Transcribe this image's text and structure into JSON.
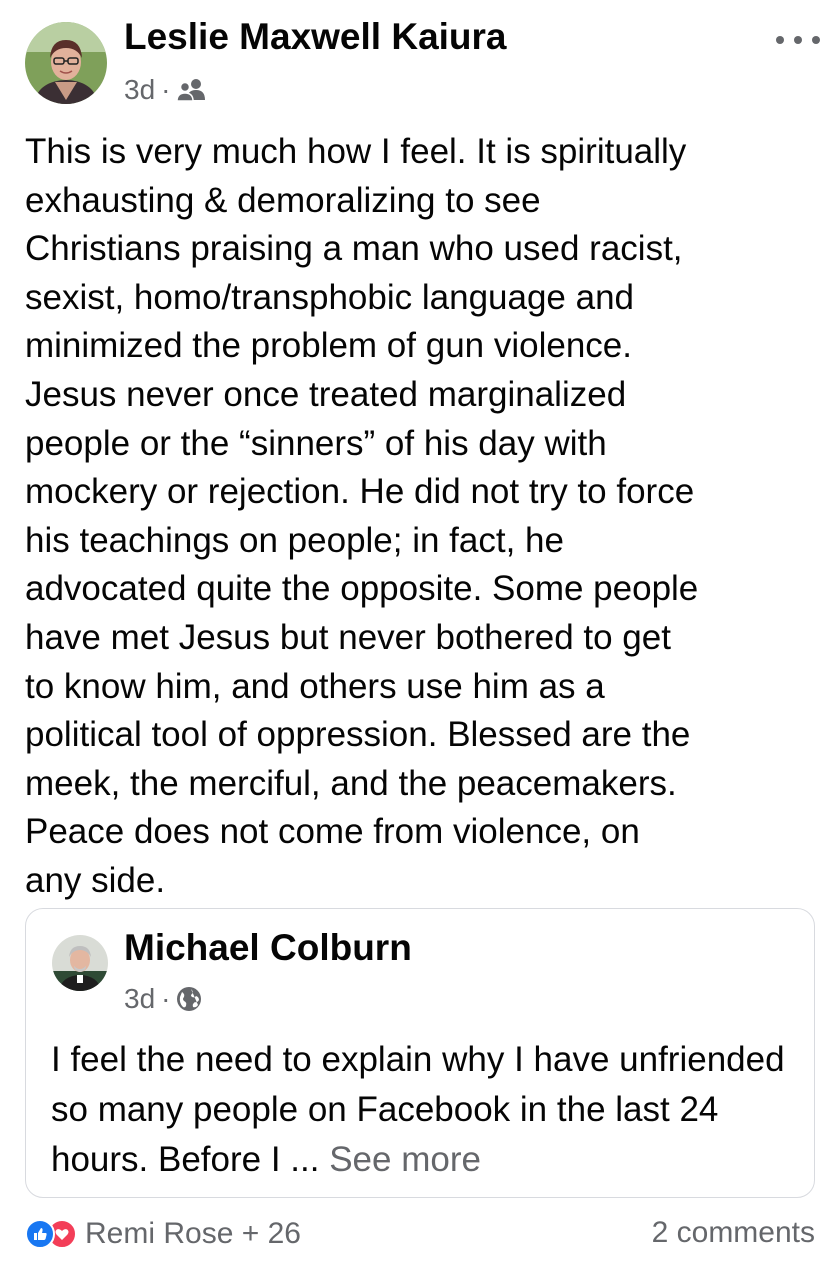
{
  "post": {
    "author_name": "Leslie Maxwell Kaiura",
    "timestamp": "3d",
    "separator": "·",
    "audience_icon": "friends-icon",
    "body": "This is very much how I feel. It is spiritually\nexhausting & demoralizing to see\nChristians praising a man who used racist,\nsexist, homo/transphobic language and\nminimized the problem of gun violence.\nJesus never once treated marginalized\npeople or the “sinners” of his day with\nmockery or rejection. He did not try to force\nhis teachings on people; in fact, he\nadvocated quite the opposite. Some people\nhave met Jesus but never bothered to get\nto know him, and others use him as a\npolitical tool of oppression. Blessed are the\nmeek, the merciful, and the peacemakers.\nPeace does not come from violence, on\nany side."
  },
  "shared": {
    "author_name": "Michael Colburn",
    "timestamp": "3d",
    "separator": "·",
    "audience_icon": "globe-icon",
    "body": "I feel the need to explain why I have unfriended so many people on Facebook in the last 24 hours. Before I ... ",
    "see_more": "See more"
  },
  "footer": {
    "reactions_text": "Remi Rose + 26",
    "comments_text": "2 comments",
    "reaction_icons": [
      "like-icon",
      "love-icon"
    ]
  },
  "colors": {
    "text_primary": "#050505",
    "text_secondary": "#65676b",
    "like_blue": "#1877f2",
    "love_red": "#f33e58",
    "card_border": "#d8dadf"
  }
}
